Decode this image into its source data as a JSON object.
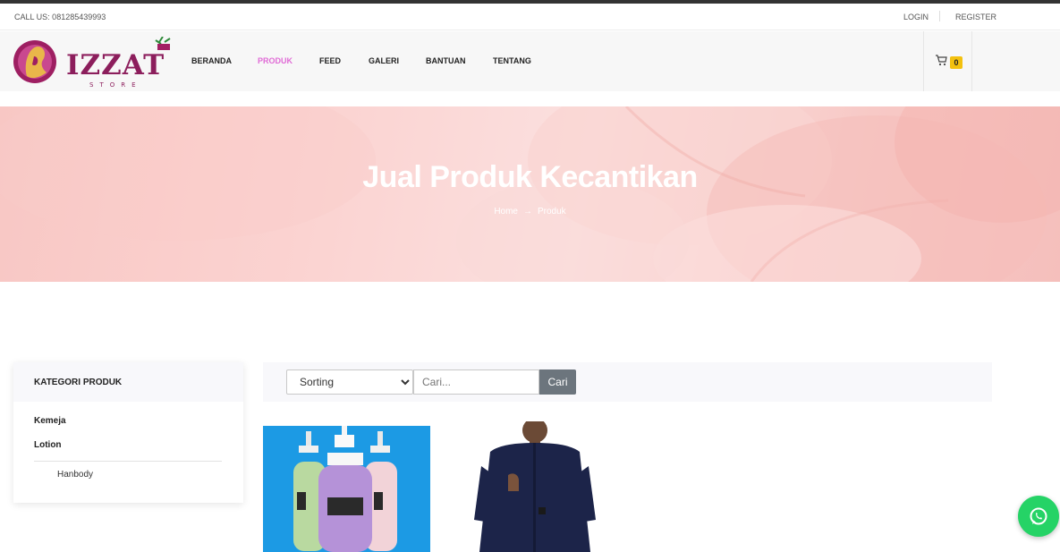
{
  "topbar": {
    "call": "CALL US: 081285439993",
    "login": "LOGIN",
    "register": "REGISTER"
  },
  "logo": {
    "name": "IZZAT",
    "sub": "STORE"
  },
  "nav": {
    "items": [
      "BERANDA",
      "PRODUK",
      "FEED",
      "GALERI",
      "BANTUAN",
      "TENTANG"
    ],
    "active": "PRODUK"
  },
  "cart": {
    "count": "0",
    "icon": "cart-icon"
  },
  "hero": {
    "title": "Jual Produk Kecantikan",
    "breadcrumb": {
      "home": "Home",
      "arrow": "→",
      "current": "Produk"
    }
  },
  "sidebar": {
    "heading": "KATEGORI PRODUK",
    "categories": [
      "Kemeja",
      "Lotion"
    ],
    "subcategory": "Hanbody"
  },
  "toolbar": {
    "sort_label": "Sorting",
    "search_placeholder": "Cari...",
    "search_button": "Cari"
  },
  "colors": {
    "accent": "#e06bd6",
    "cart_badge": "#f3c10f",
    "whatsapp": "#25d366",
    "search_button": "#6c757d"
  }
}
